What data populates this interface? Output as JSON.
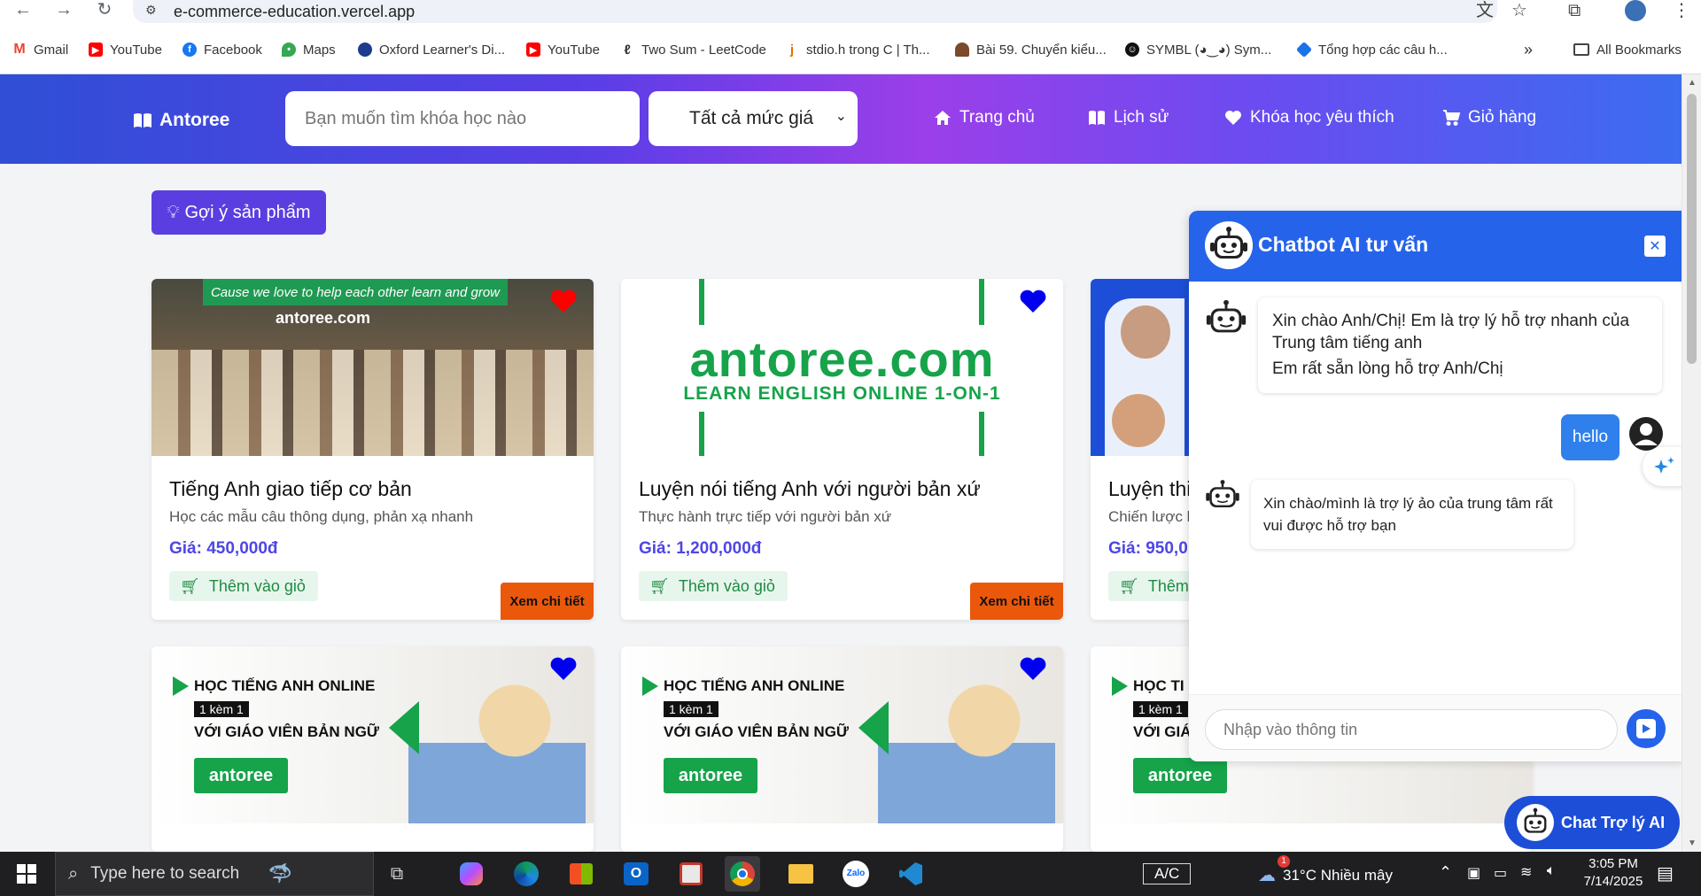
{
  "browser": {
    "url": "e-commerce-education.vercel.app",
    "bookmarks": [
      {
        "label": "Gmail",
        "icon": "gmail-icon",
        "color": "#ea4335"
      },
      {
        "label": "YouTube",
        "icon": "youtube-icon",
        "color": "#ff0000"
      },
      {
        "label": "Facebook",
        "icon": "facebook-icon",
        "color": "#1877f2"
      },
      {
        "label": "Maps",
        "icon": "maps-icon",
        "color": "#34a853"
      },
      {
        "label": "Oxford Learner's Di...",
        "icon": "oxford-icon",
        "color": "#1d3b8f"
      },
      {
        "label": "YouTube",
        "icon": "youtube-icon",
        "color": "#ff0000"
      },
      {
        "label": "Two Sum - LeetCode",
        "icon": "leetcode-icon",
        "color": "#f89f1b"
      },
      {
        "label": "stdio.h trong C | Th...",
        "icon": "java-icon",
        "color": "#e76f00"
      },
      {
        "label": "Bài 59. Chuyển kiểu...",
        "icon": "person-icon",
        "color": "#7a4a2b"
      },
      {
        "label": "SYMBL (◕‿◕) Sym...",
        "icon": "symbl-icon",
        "color": "#111111"
      },
      {
        "label": "Tổng hợp các câu h...",
        "icon": "diamond-icon",
        "color": "#1a73e8"
      }
    ],
    "all_bookmarks": "All Bookmarks"
  },
  "header": {
    "logo": "Antoree",
    "search_placeholder": "Bạn muốn tìm khóa học nào",
    "price_filter": "Tất cả mức giá",
    "nav": [
      "Trang chủ",
      "Lịch sử",
      "Khóa học yêu thích",
      "Giỏ hàng"
    ]
  },
  "suggest_button": "Gợi ý sản phẩm",
  "products": [
    {
      "title": "Tiếng Anh giao tiếp cơ bản",
      "desc": "Học các mẫu câu thông dụng, phản xạ nhanh",
      "price": "Giá: 450,000đ",
      "add_to_cart": "Thêm vào giỏ",
      "detail": "Xem chi tiết",
      "favorite": true,
      "banner_top": "Cause we love to help each other learn and grow",
      "banner_brand": "antoree.com"
    },
    {
      "title": "Luyện nói tiếng Anh với người bản xứ",
      "desc": "Thực hành trực tiếp với người bản xứ",
      "price": "Giá: 1,200,000đ",
      "add_to_cart": "Thêm vào giỏ",
      "detail": "Xem chi tiết",
      "favorite": false,
      "banner_brand": "antoree.com",
      "banner_sub": "LEARN ENGLISH ONLINE 1-ON-1"
    },
    {
      "title": "Luyện thi",
      "desc": "Chiến lược l",
      "price": "Giá: 950,0",
      "add_to_cart": "Thêm",
      "favorite": false
    }
  ],
  "promo": {
    "line1": "HỌC TIẾNG ANH ONLINE",
    "line2": "1 kèm 1",
    "line3": "VỚI GIÁO VIÊN BẢN NGỮ",
    "brand": "antoree",
    "line1_cut": "HỌC TI",
    "line2_cut": "1 kèm 1",
    "line3_cut": "VỚI GIÁ"
  },
  "chat": {
    "title": "Chatbot AI tư vấn",
    "greeting_lines": [
      "Xin chào Anh/Chị! Em là trợ lý hỗ trợ nhanh của Trung tâm tiếng anh",
      "Em rất sẵn lòng hỗ trợ Anh/Chị"
    ],
    "user_message": "hello",
    "bot_reply": "Xin chào/mình là trợ lý ảo của trung tâm rất vui được hỗ trợ bạn",
    "input_placeholder": "Nhập vào thông tin",
    "floating_button": "Chat Trợ lý AI"
  },
  "taskbar": {
    "search_placeholder": "Type here to search",
    "keyboard": "A/C",
    "weather": "31°C  Nhiều mây",
    "time": "3:05 PM",
    "date": "7/14/2025",
    "notification_badge": "1"
  },
  "colors": {
    "accent": "#5b3ee0",
    "chat_header": "#2563eb",
    "detail_button": "#ea580c",
    "favorite_on": "#ff0000",
    "favorite_off": "#0000ee"
  }
}
